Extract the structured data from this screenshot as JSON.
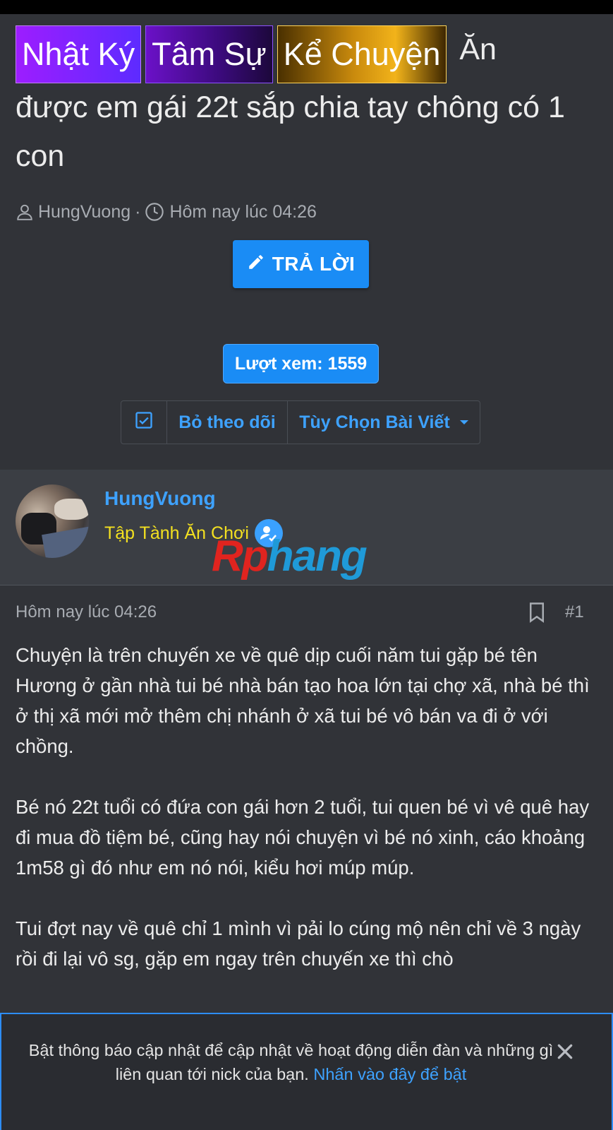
{
  "thread": {
    "prefixes": [
      "Nhật Ký",
      "Tâm Sự",
      "Kể Chuyện"
    ],
    "title_word1": "Ăn",
    "title_rest": "được em gái 22t sắp chia tay chông có 1 con",
    "author": "HungVuong",
    "meta_separator": "·",
    "date": "Hôm nay lúc 04:26",
    "reply_label": "TRẢ LỜI",
    "views_label": "Lượt xem: 1559",
    "unfollow_label": "Bỏ theo dõi",
    "options_label": "Tùy Chọn Bài Viết"
  },
  "user": {
    "name": "HungVuong",
    "title": "Tập Tành Ăn Chơi"
  },
  "watermark": {
    "part1": "Rp",
    "part2": "hang"
  },
  "post": {
    "date": "Hôm nay lúc 04:26",
    "number": "#1",
    "paragraphs": [
      "Chuyện là trên chuyến xe về quê dịp cuối năm tui gặp bé tên Hương ở gần nhà tui bé nhà bán tạo hoa lớn tại chợ xã, nhà bé thì ở thị xã mới mở thêm chị nhánh ở xã tui bé vô bán va đi ở với chồng.",
      "Bé nó 22t tuổi có đứa con gái hơn 2 tuổi, tui quen bé vì vê quê hay đi mua đồ tiệm bé, cũng hay nói chuyện vì bé nó xinh, cáo khoảng 1m58 gì đó như em nó nói, kiểu hơi múp múp.",
      "Tui đợt nay về quê chỉ 1 mình vì pải lo cúng mộ nên chỉ về 3 ngày rồi đi lại vô sg, gặp em ngay trên chuyến xe thì chò"
    ]
  },
  "notice": {
    "text": "Bật thông báo cập nhật để cập nhật về hoạt động diễn đàn và những gì liên quan tới nick của bạn.",
    "link": "Nhấn vào đây để bật"
  },
  "colors": {
    "accent": "#1a8cf5",
    "link": "#3ea2ff",
    "user_title": "#f3e020",
    "background": "#313338"
  }
}
